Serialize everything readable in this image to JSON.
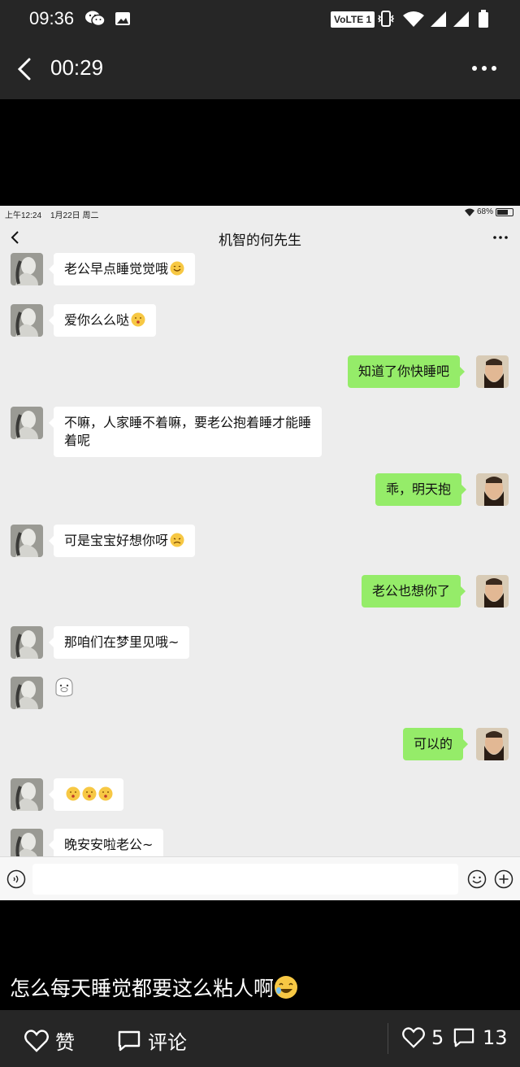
{
  "status_bar": {
    "time": "09:36",
    "network_badge": "VoLTE 1",
    "icons": [
      "wechat-icon",
      "image-icon",
      "vibrate-icon",
      "wifi-icon",
      "signal-icon",
      "battery-icon"
    ]
  },
  "header": {
    "back_icon": "chevron-left-icon",
    "duration": "00:29",
    "more_icon": "more-dots-icon"
  },
  "screenshot": {
    "status": {
      "time": "上午12:24",
      "date": "1月22日 周二",
      "battery": "68%"
    },
    "chat_title": "机智的何先生",
    "messages": [
      {
        "side": "left",
        "text": "老公早点睡觉觉哦",
        "emoji": "smile-emoji"
      },
      {
        "side": "left",
        "text": "爱你么么哒",
        "emoji": "kiss-emoji"
      },
      {
        "side": "right",
        "text": "知道了你快睡吧"
      },
      {
        "side": "left",
        "text": "不嘛，人家睡不着嘛，要老公抱着睡才能睡着呢"
      },
      {
        "side": "right",
        "text": "乖，明天抱"
      },
      {
        "side": "left",
        "text": "可是宝宝好想你呀",
        "emoji": "sad-emoji"
      },
      {
        "side": "right",
        "text": "老公也想你了"
      },
      {
        "side": "left",
        "text": "那咱们在梦里见哦~"
      },
      {
        "side": "left",
        "text": "",
        "emoji": "pig-sticker"
      },
      {
        "side": "right",
        "text": "可以的"
      },
      {
        "side": "left",
        "text": "",
        "emoji": "kiss-emoji-x3"
      },
      {
        "side": "left",
        "text": "晚安安啦老公~"
      }
    ]
  },
  "caption": {
    "text": "怎么每天睡觉都要这么粘人啊",
    "emoji": "laughing-emoji"
  },
  "bottom_bar": {
    "like_label": "赞",
    "comment_label": "评论",
    "like_count": "5",
    "comment_count": "13"
  },
  "colors": {
    "bar_bg": "#262626",
    "chat_bg": "#ededed",
    "bubble_sent": "#95ec69",
    "bubble_received": "#ffffff"
  }
}
